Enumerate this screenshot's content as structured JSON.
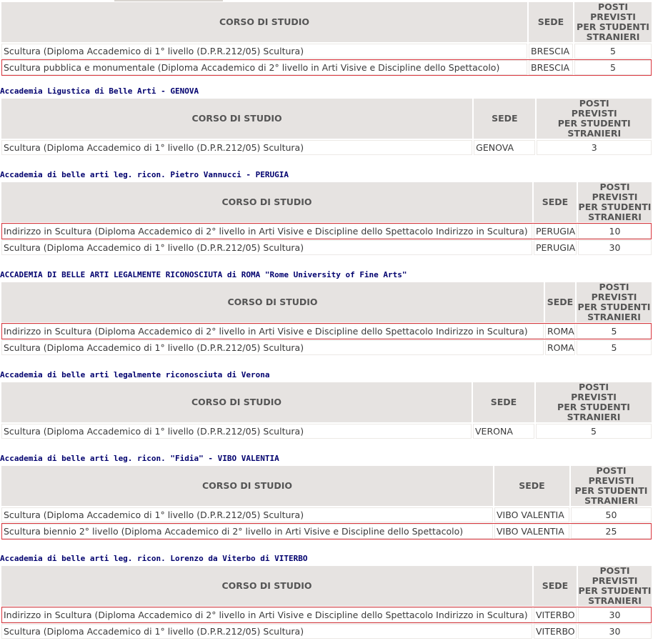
{
  "headers": {
    "course": "CORSO DI STUDIO",
    "seat": "SEDE",
    "places_l1": "POSTI",
    "places_l2": "PREVISTI",
    "places_l3": "PER STUDENTI",
    "places_l4": "STRANIERI"
  },
  "colors": {
    "title": "#00006e",
    "header_bg": "#e6e3e1",
    "highlight": "#d9363e"
  },
  "sections": [
    {
      "title": "",
      "rows": [
        {
          "course": "Scultura (Diploma Accademico di 1° livello (D.P.R.212/05) Scultura)",
          "seat": "BRESCIA",
          "places": "5",
          "highlighted": false
        },
        {
          "course": "Scultura pubblica e monumentale (Diploma Accademico di 2° livello in Arti Visive e Discipline dello Spettacolo)",
          "seat": "BRESCIA",
          "places": "5",
          "highlighted": true
        }
      ]
    },
    {
      "title": "Accademia Ligustica di Belle Arti - GENOVA",
      "rows": [
        {
          "course": "Scultura (Diploma Accademico di 1° livello (D.P.R.212/05) Scultura)",
          "seat": "GENOVA",
          "places": "3",
          "highlighted": false
        }
      ]
    },
    {
      "title": "Accademia di belle arti leg. ricon. Pietro Vannucci - PERUGIA",
      "rows": [
        {
          "course": "Indirizzo in Scultura (Diploma Accademico di 2° livello in Arti Visive e Discipline dello Spettacolo Indirizzo in Scultura)",
          "seat": "PERUGIA",
          "places": "10",
          "highlighted": true
        },
        {
          "course": "Scultura (Diploma Accademico di 1° livello (D.P.R.212/05) Scultura)",
          "seat": "PERUGIA",
          "places": "30",
          "highlighted": false
        }
      ]
    },
    {
      "title": "ACCADEMIA DI BELLE ARTI LEGALMENTE RICONOSCIUTA di ROMA \"Rome University of Fine Arts\"",
      "rows": [
        {
          "course": "Indirizzo in Scultura (Diploma Accademico di 2° livello in Arti Visive e Discipline dello Spettacolo Indirizzo in Scultura)",
          "seat": "ROMA",
          "places": "5",
          "highlighted": true
        },
        {
          "course": "Scultura (Diploma Accademico di 1° livello (D.P.R.212/05) Scultura)",
          "seat": "ROMA",
          "places": "5",
          "highlighted": false
        }
      ]
    },
    {
      "title": "Accademia di belle arti legalmente riconosciuta di Verona",
      "rows": [
        {
          "course": "Scultura (Diploma Accademico di 1° livello (D.P.R.212/05) Scultura)",
          "seat": "VERONA",
          "places": "5",
          "highlighted": false
        }
      ]
    },
    {
      "title": "Accademia di belle arti leg. ricon. \"Fidia\" - VIBO VALENTIA",
      "rows": [
        {
          "course": "Scultura (Diploma Accademico di 1° livello (D.P.R.212/05) Scultura)",
          "seat": "VIBO VALENTIA",
          "places": "50",
          "highlighted": false
        },
        {
          "course": "Scultura biennio 2° livello (Diploma Accademico di 2° livello in Arti Visive e Discipline dello Spettacolo)",
          "seat": "VIBO VALENTIA",
          "places": "25",
          "highlighted": true
        }
      ]
    },
    {
      "title": "Accademia di belle arti leg. ricon. Lorenzo da Viterbo di VITERBO",
      "rows": [
        {
          "course": "Indirizzo in Scultura (Diploma Accademico di 2° livello in Arti Visive e Discipline dello Spettacolo Indirizzo in Scultura)",
          "seat": "VITERBO",
          "places": "30",
          "highlighted": true
        },
        {
          "course": "Scultura (Diploma Accademico di 1° livello (D.P.R.212/05) Scultura)",
          "seat": "VITERBO",
          "places": "30",
          "highlighted": false
        }
      ]
    }
  ]
}
